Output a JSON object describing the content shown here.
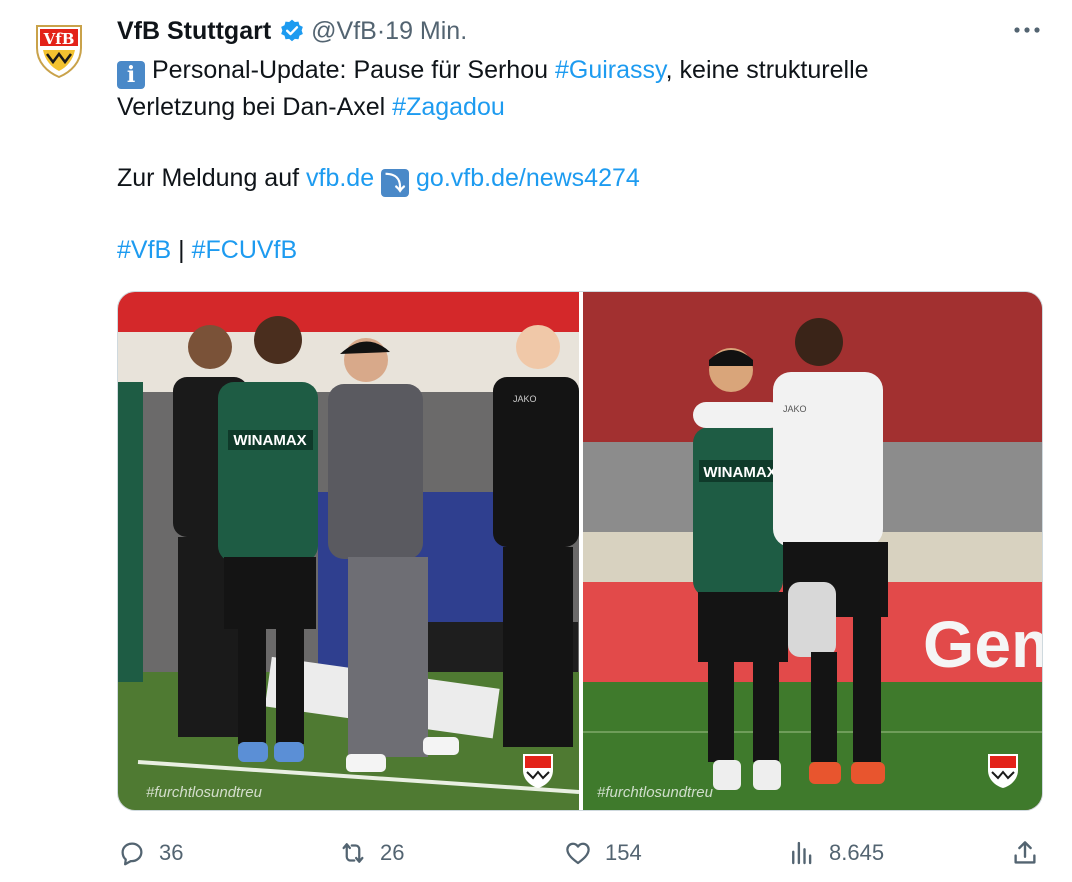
{
  "tweet": {
    "author_name": "VfB Stuttgart",
    "handle": "@VfB",
    "separator": " · ",
    "time": "19 Min.",
    "lines": {
      "l1_emoji": "i",
      "l1_text": " Personal-Update: Pause für Serhou ",
      "l1_tag": "#Guirassy",
      "l1_rest": ", keine strukturelle",
      "l2_text": "Verletzung bei Dan-Axel ",
      "l2_tag": "#Zagadou",
      "l3_text": "Zur Meldung auf ",
      "l3_link": "vfb.de",
      "l3_emoji": "⤵",
      "l3_url": "go.vfb.de/news4274",
      "l4_tag1": "#VfB",
      "l4_sep": " | ",
      "l4_tag2": "#FCUVfB"
    },
    "logo_text": "VfB",
    "images": {
      "left": {
        "shirt_text": "WINAMAX",
        "kit_text": "JAKO",
        "watermark": "#furchtlosundtreu"
      },
      "right": {
        "shirt_text": "WINAMAX",
        "kit_text": "JAKO",
        "watermark": "#furchtlosundtreu",
        "board_text": "Gem"
      }
    },
    "actions": {
      "replies": "36",
      "reposts": "26",
      "likes": "154",
      "views": "8.645"
    }
  },
  "colors": {
    "link": "#1d9bf0",
    "verified": "#1d9bf0",
    "vfb_red": "#e32219",
    "kit_green": "#1e5c44",
    "pitch": "#4f7a32"
  },
  "icons": [
    "vfb-logo-icon",
    "verified-icon",
    "more-icon",
    "reply-icon",
    "repost-icon",
    "like-icon",
    "views-icon",
    "share-icon"
  ]
}
